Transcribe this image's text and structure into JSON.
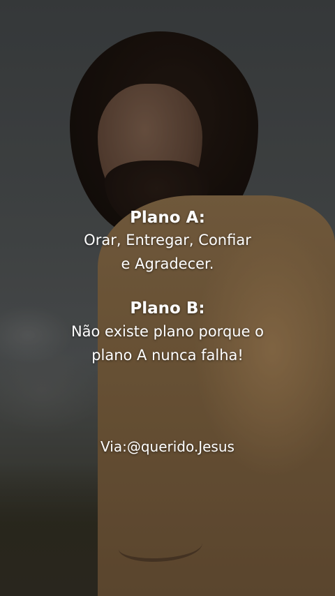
{
  "post": {
    "plan_a": {
      "heading": "Plano A:",
      "line1": "Orar, Entregar, Confiar",
      "line2": "e Agradecer."
    },
    "plan_b": {
      "heading": "Plano B:",
      "line1": "Não existe plano porque o",
      "line2": "plano A nunca falha!"
    },
    "credit": "Via:@querido.Jesus"
  }
}
